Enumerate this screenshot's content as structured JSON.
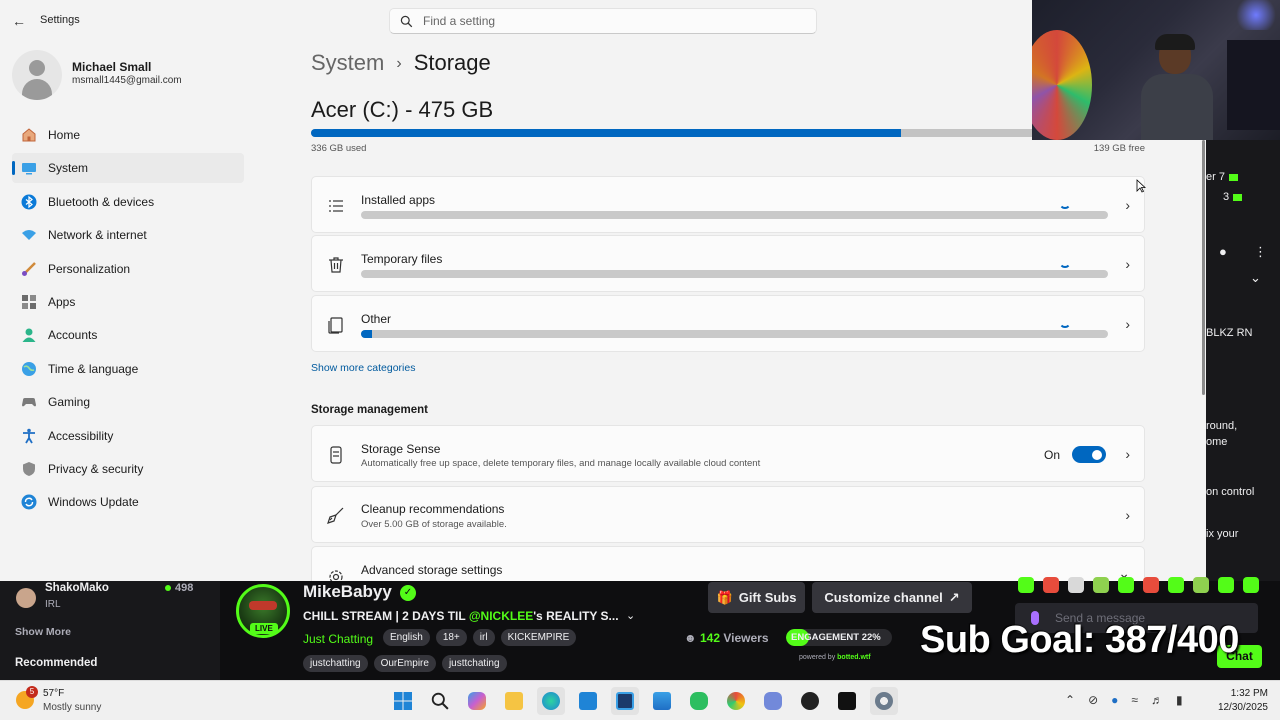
{
  "window": {
    "app_title": "Settings",
    "search_placeholder": "Find a setting"
  },
  "profile": {
    "name": "Michael Small",
    "email": "msmall1445@gmail.com"
  },
  "nav": [
    {
      "label": "Home",
      "icon": "home-icon"
    },
    {
      "label": "System",
      "icon": "system-icon",
      "active": true
    },
    {
      "label": "Bluetooth & devices",
      "icon": "bluetooth-icon"
    },
    {
      "label": "Network & internet",
      "icon": "wifi-icon"
    },
    {
      "label": "Personalization",
      "icon": "brush-icon"
    },
    {
      "label": "Apps",
      "icon": "apps-icon"
    },
    {
      "label": "Accounts",
      "icon": "accounts-icon"
    },
    {
      "label": "Time & language",
      "icon": "globe-icon"
    },
    {
      "label": "Gaming",
      "icon": "gamepad-icon"
    },
    {
      "label": "Accessibility",
      "icon": "accessibility-icon"
    },
    {
      "label": "Privacy & security",
      "icon": "shield-icon"
    },
    {
      "label": "Windows Update",
      "icon": "update-icon"
    }
  ],
  "breadcrumb": {
    "parent": "System",
    "sep": "›",
    "current": "Storage"
  },
  "drive": {
    "title": "Acer (C:) - 475 GB",
    "used_label": "336 GB used",
    "free_label": "139 GB free",
    "used_fraction": 0.707
  },
  "categories": [
    {
      "label": "Installed apps",
      "icon": "list-icon",
      "fraction": 0
    },
    {
      "label": "Temporary files",
      "icon": "trash-icon",
      "fraction": 0
    },
    {
      "label": "Other",
      "icon": "document-icon",
      "fraction": 0.015
    }
  ],
  "show_more": "Show more categories",
  "storage_management": {
    "title": "Storage management",
    "storage_sense": {
      "title": "Storage Sense",
      "subtitle": "Automatically free up space, delete temporary files, and manage locally available cloud content",
      "state": "On"
    },
    "cleanup": {
      "title": "Cleanup recommendations",
      "subtitle": "Over 5.00 GB of storage available."
    },
    "advanced": {
      "title": "Advanced storage settings"
    }
  },
  "right_chat": {
    "line1": "er 7",
    "line2": "3",
    "line3": "BLKZ RN",
    "line4": "round,",
    "line5": "ome",
    "line6": "on control",
    "line7": "ix your"
  },
  "stream": {
    "followed_channel": {
      "name": "ShakoMako",
      "category": "IRL",
      "viewers": "498"
    },
    "show_more": "Show More",
    "recommended": "Recommended",
    "streamer": "MikeBabyy",
    "live_label": "LIVE",
    "title_prefix": "CHILL STREAM | 2  DAYS TIL ",
    "title_mention": "@NICKLEE",
    "title_suffix": "'s REALITY S...",
    "category": "Just Chatting",
    "tags": [
      "English",
      "18+",
      "irl",
      "KICKEMPIRE"
    ],
    "tags2": [
      "justchatting",
      "OurEmpire",
      "justtchating"
    ],
    "gift_subs": "Gift Subs",
    "customize": "Customize channel",
    "viewers_num": "142",
    "viewers_label": "Viewers",
    "engagement": "ENGAGEMENT 22%",
    "engagement_value": 0.22,
    "powered_prefix": "powered by ",
    "powered_brand": "botted.wtf",
    "sub_goal": "Sub Goal: 387/400",
    "chat_placeholder": "Send a message",
    "chat_button": "Chat"
  },
  "taskbar": {
    "weather_temp": "57°F",
    "weather_cond": "Mostly sunny",
    "weather_badge": "5",
    "time": "1:32 PM",
    "date": "12/30/2025"
  },
  "colors": {
    "accent": "#0067c0",
    "kick_green": "#53fc18"
  }
}
